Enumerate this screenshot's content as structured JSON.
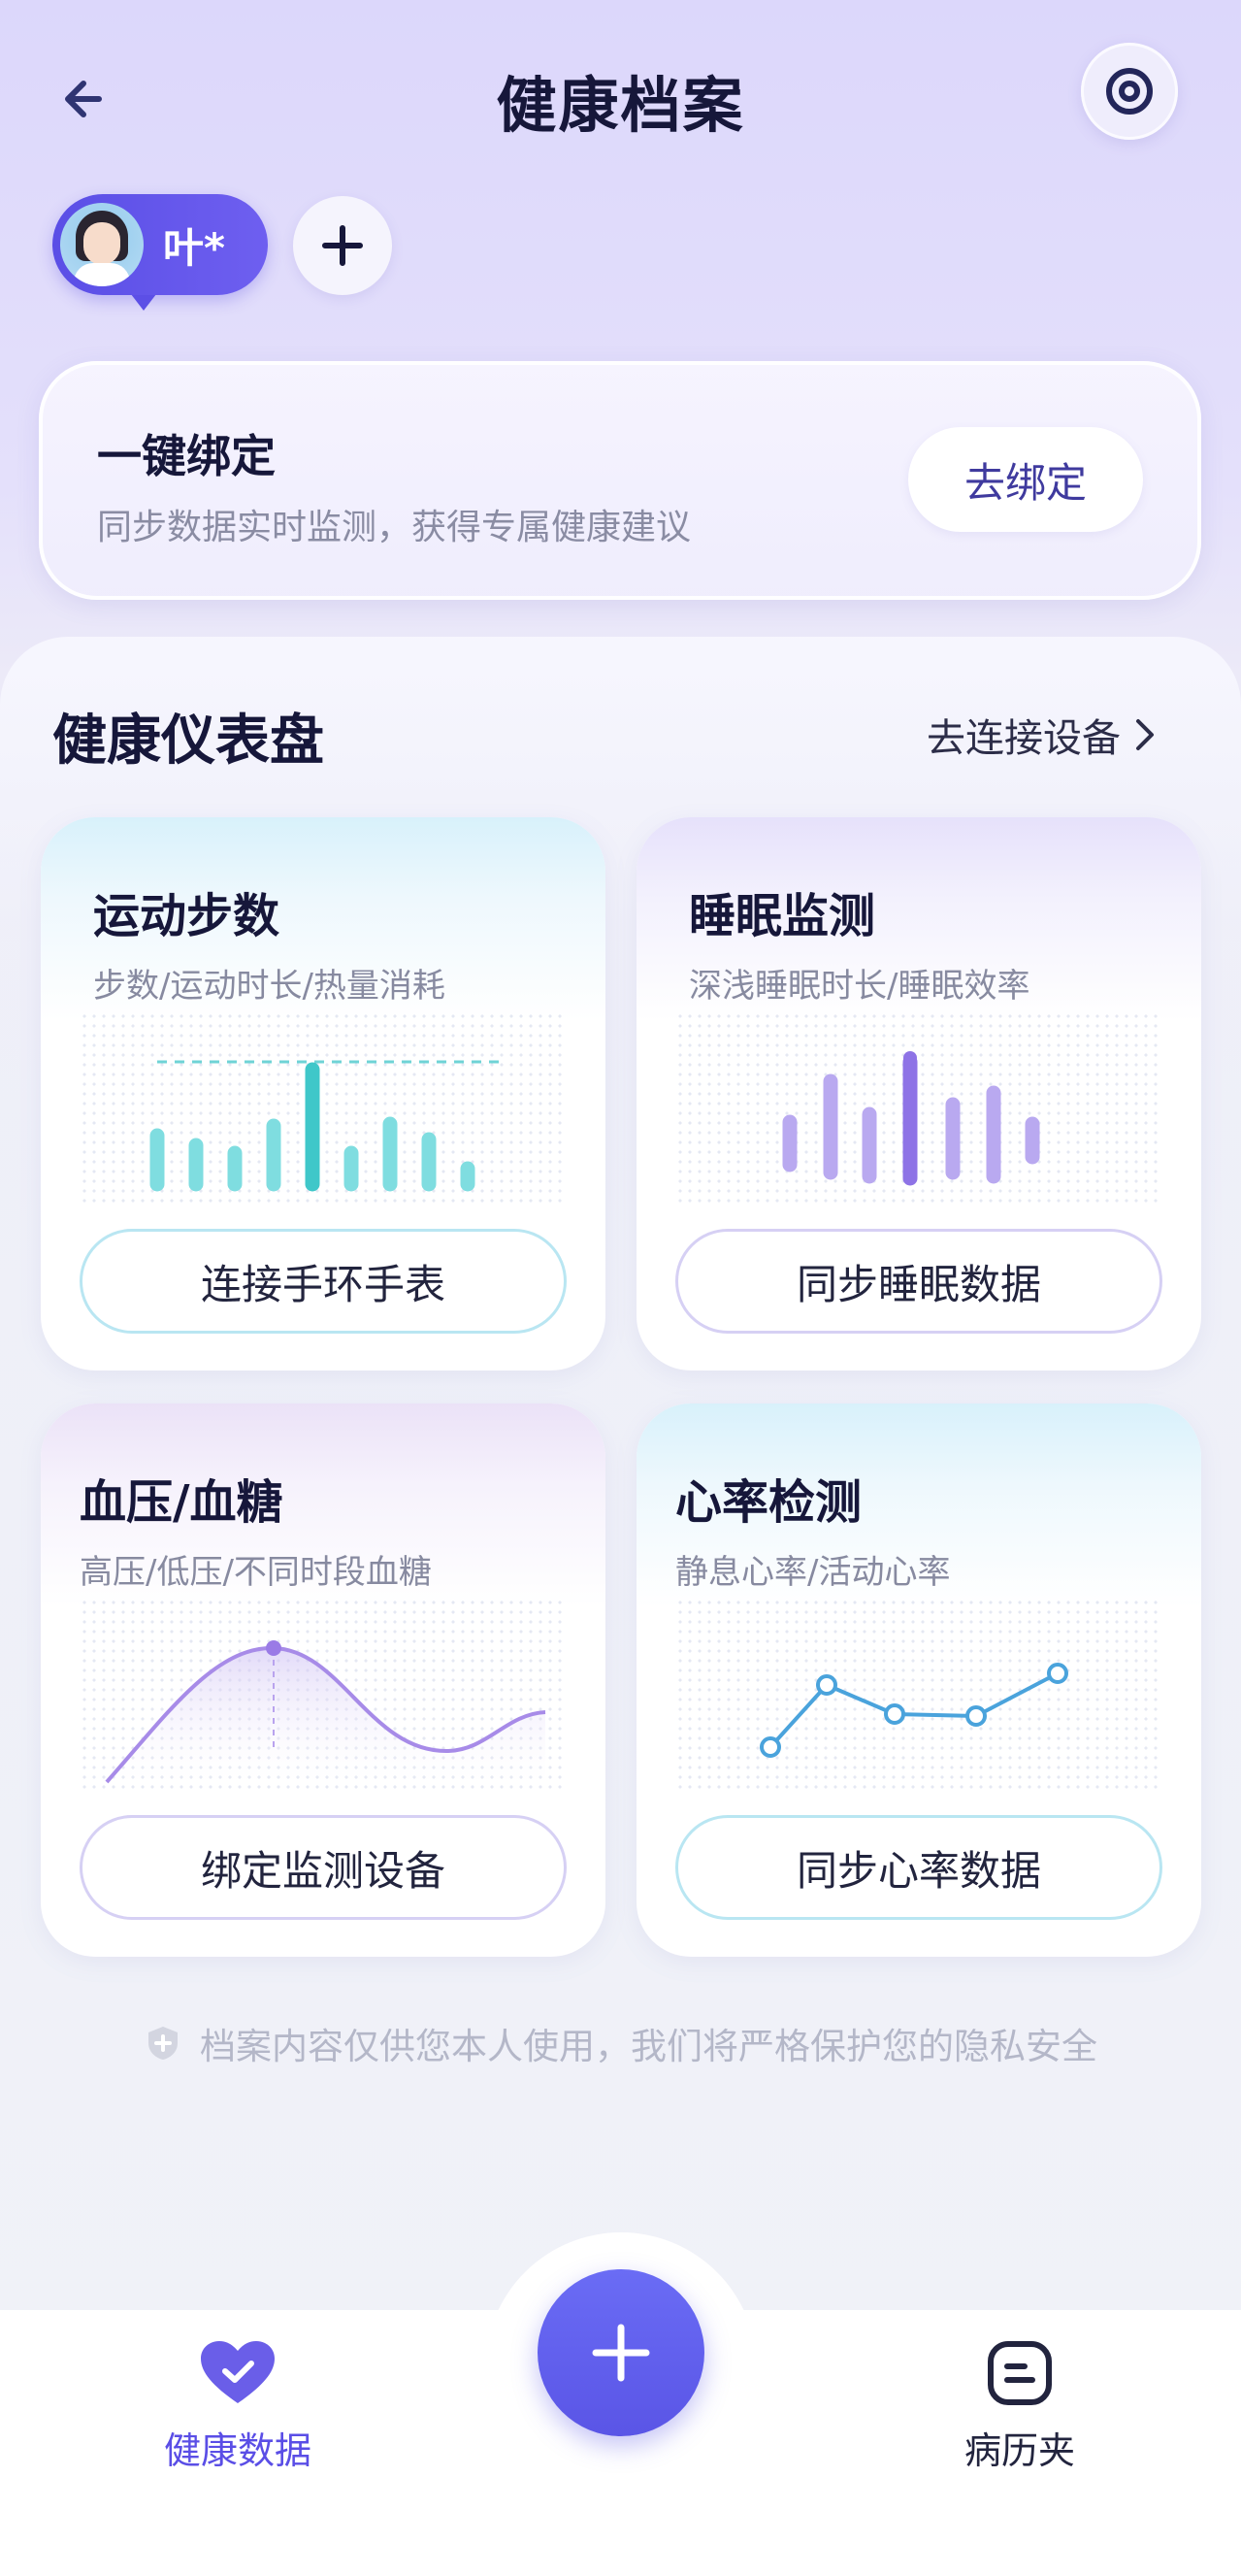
{
  "header": {
    "title": "健康档案"
  },
  "profile": {
    "name": "叶*"
  },
  "bind_card": {
    "title": "一键绑定",
    "subtitle": "同步数据实时监测，获得专属健康建议",
    "button": "去绑定"
  },
  "dashboard": {
    "title": "健康仪表盘",
    "link": "去连接设备",
    "cards": [
      {
        "title": "运动步数",
        "subtitle": "步数/运动时长/热量消耗",
        "button": "连接手环手表"
      },
      {
        "title": "睡眠监测",
        "subtitle": "深浅睡眠时长/睡眠效率",
        "button": "同步睡眠数据"
      },
      {
        "title": "血压/血糖",
        "subtitle": "高压/低压/不同时段血糖",
        "button": "绑定监测设备"
      },
      {
        "title": "心率检测",
        "subtitle": "静息心率/活动心率",
        "button": "同步心率数据"
      }
    ]
  },
  "privacy_note": "档案内容仅供您本人使用，我们将严格保护您的隐私安全",
  "bottom_nav": {
    "health_data": "健康数据",
    "records": "病历夹"
  },
  "colors": {
    "accent": "#5a4ee6",
    "steps_bar": "#7fdde0",
    "steps_bar_highlight": "#3fc7c9",
    "sleep_bar": "#b9a9f0",
    "sleep_bar_highlight": "#8e73e6",
    "heart_line": "#4aa3dc",
    "bp_line": "#a78be8"
  }
}
